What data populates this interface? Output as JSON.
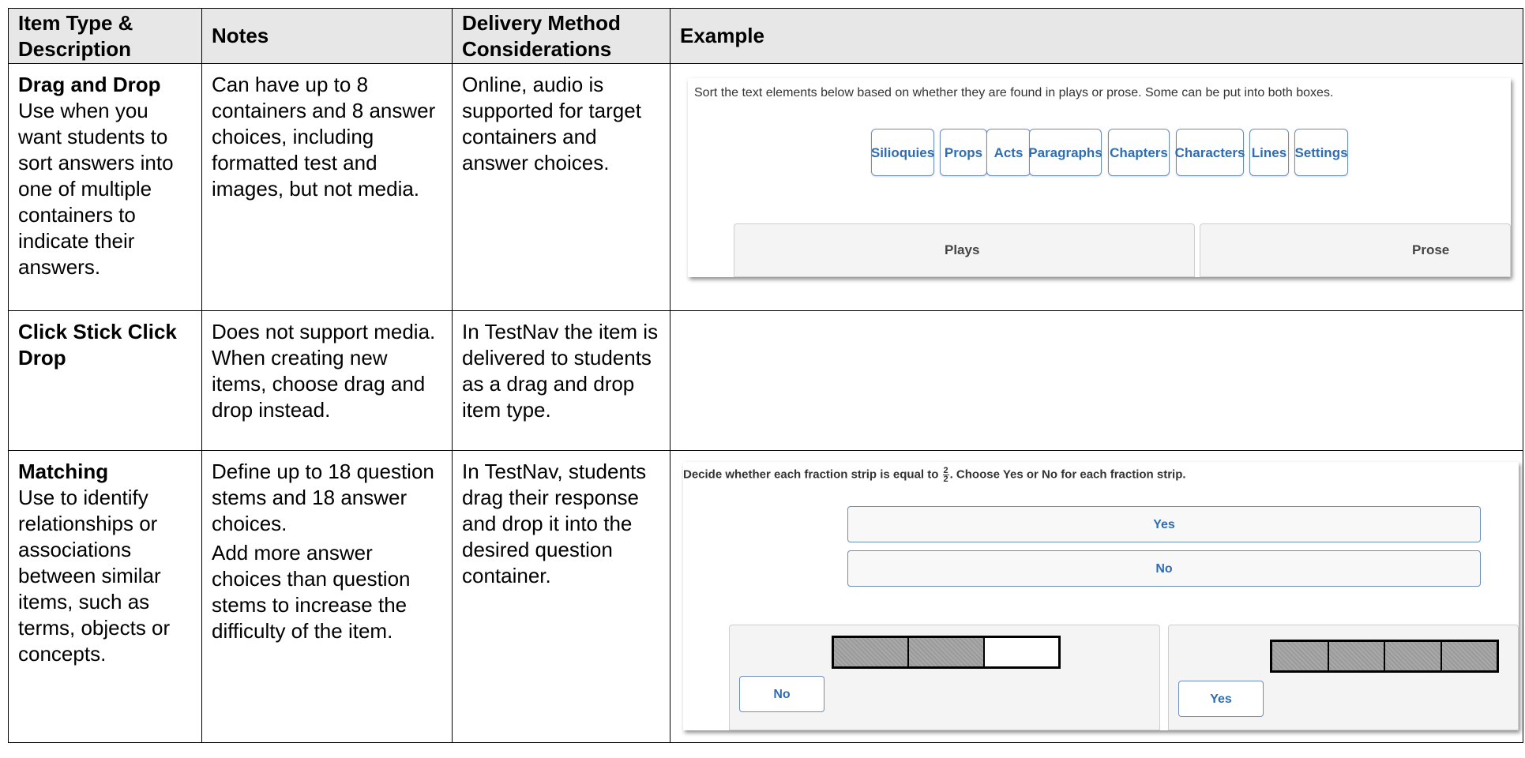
{
  "headers": {
    "col1": "Item Type & Description",
    "col2": "Notes",
    "col3": "Delivery Method Considerations",
    "col4": "Example"
  },
  "rows": [
    {
      "title": "Drag and Drop",
      "description": "Use when you want students to sort answers into one of multiple containers to indicate their answers.",
      "notes": [
        "Can have up to 8 containers and 8 answer choices, including formatted test and images, but not media."
      ],
      "delivery": "Online, audio is supported for target containers and answer choices."
    },
    {
      "title": "Click Stick Click Drop",
      "description": "",
      "notes": [
        "Does not support media. When creating new items, choose drag and drop instead."
      ],
      "delivery": "In TestNav the item is delivered to students as a drag and drop item type."
    },
    {
      "title": "Matching",
      "description": "Use to identify relationships or associations between similar items, such as terms, objects or concepts.",
      "notes": [
        "Define up to 18 question stems and 18 answer choices.",
        "Add more answer choices than question stems to increase the difficulty of the item."
      ],
      "delivery": "In TestNav, students drag their response and drop it into the desired question container."
    }
  ],
  "example_drag_drop": {
    "prompt": "Sort the text elements below based on whether they are found in plays or prose. Some can be put into both boxes.",
    "chips": [
      "Silioquies",
      "Props",
      "Acts",
      "Paragraphs",
      "Chapters",
      "Characters",
      "Lines",
      "Settings"
    ],
    "containers": [
      "Plays",
      "Prose"
    ]
  },
  "example_matching": {
    "prompt_before": "Decide whether each fraction strip is equal to",
    "fraction_numerator": "2",
    "fraction_denominator": "2",
    "prompt_after": ". Choose Yes or No for each fraction strip.",
    "options": [
      "Yes",
      "No"
    ],
    "left_container_answer": "No",
    "right_container_answer": "Yes",
    "left_strip_shaded": 2,
    "left_strip_total": 3,
    "right_strip_shaded": 4,
    "right_strip_total": 4
  }
}
